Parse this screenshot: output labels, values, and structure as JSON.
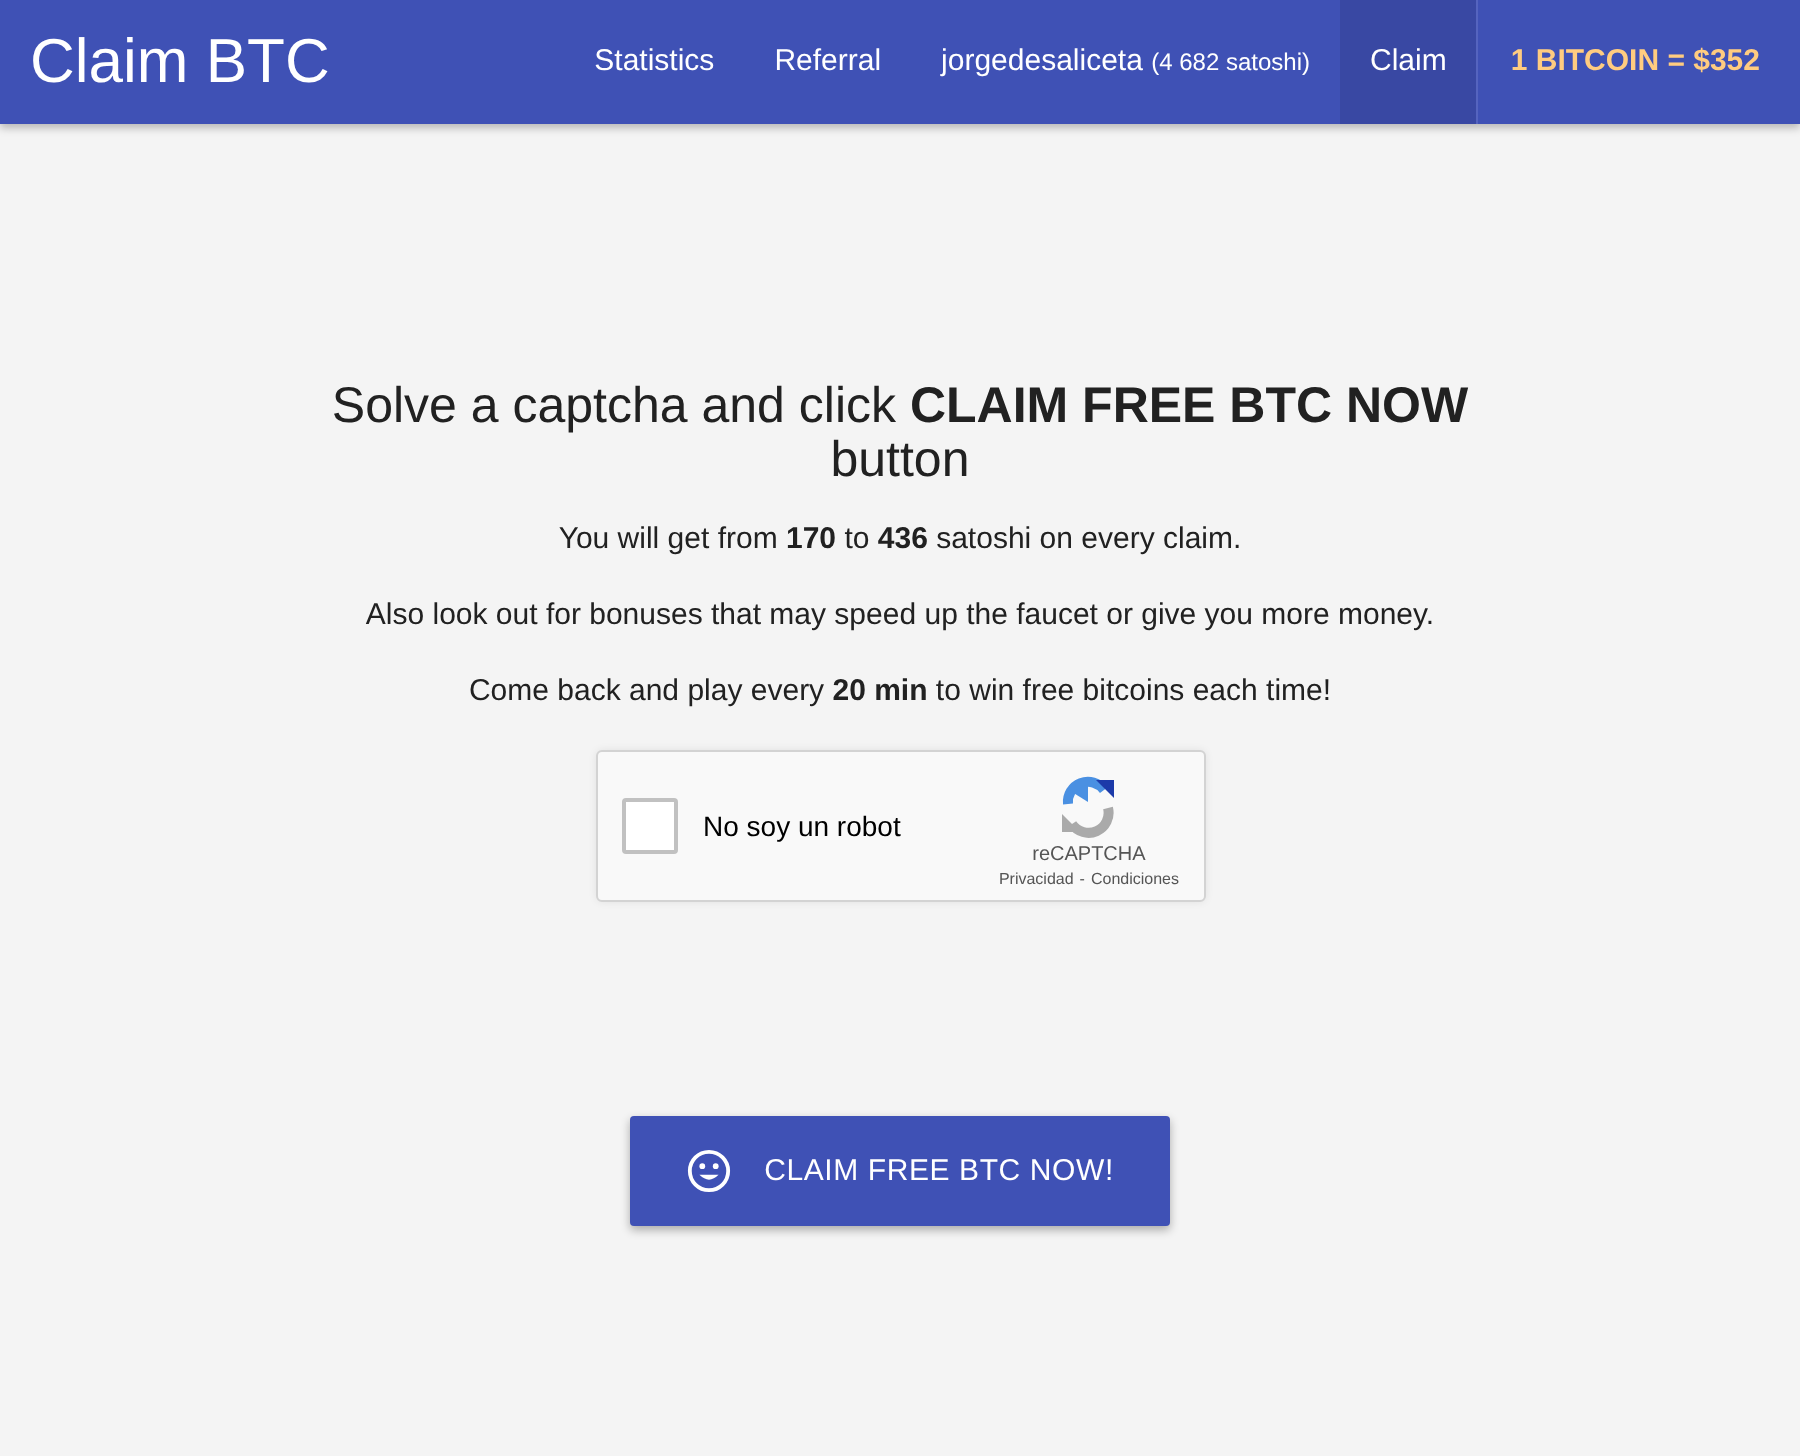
{
  "header": {
    "title": "Claim BTC",
    "nav": [
      {
        "label": "Statistics",
        "selected": false
      },
      {
        "label": "Referral",
        "selected": false
      },
      {
        "label": "jorgedesaliceta",
        "note": "(4 682 satoshi)",
        "selected": false
      },
      {
        "label": "Claim",
        "selected": true
      }
    ],
    "price": "1 BITCOIN = $352"
  },
  "main": {
    "heading": "Solve a captcha and click **CLAIM FREE BTC NOW** button",
    "paragraphs": [
      "You will get from **170** to **436** satoshi on every claim.",
      "Also look out for bonuses that may speed up the faucet or give you more money.",
      "Come back and play every **20 min** to win free bitcoins each time!"
    ]
  },
  "captcha": {
    "label": "No soy un robot",
    "checked": false,
    "brand": "reCAPTCHA",
    "links": [
      "Privacidad",
      "Condiciones"
    ],
    "separator": "-"
  },
  "claim_button": {
    "label": "CLAIM FREE BTC NOW!"
  }
}
